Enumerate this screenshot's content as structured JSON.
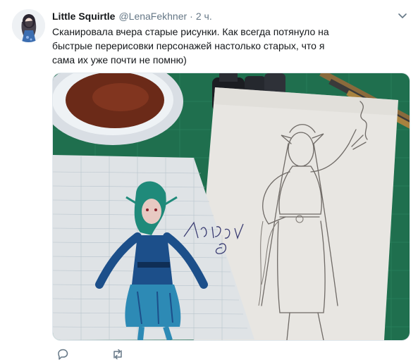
{
  "tweet": {
    "user": {
      "name": "Little Squirtle",
      "handle": "@LenaFekhner",
      "separator": "·",
      "time": "2 ч."
    },
    "text": "Сканировала вчера старые рисунки. Как всегда потянуло на быстрые перерисовки персонажей настолько старых, что я сама их уже почти не помню)",
    "media": {
      "sketch_signature": "Лейсона"
    },
    "icons": {
      "more": "chevron-down-icon",
      "reply": "reply-icon",
      "retweet": "retweet-icon"
    },
    "colors": {
      "text": "#14171a",
      "muted": "#657786",
      "mat": "#1f6f4e"
    }
  }
}
